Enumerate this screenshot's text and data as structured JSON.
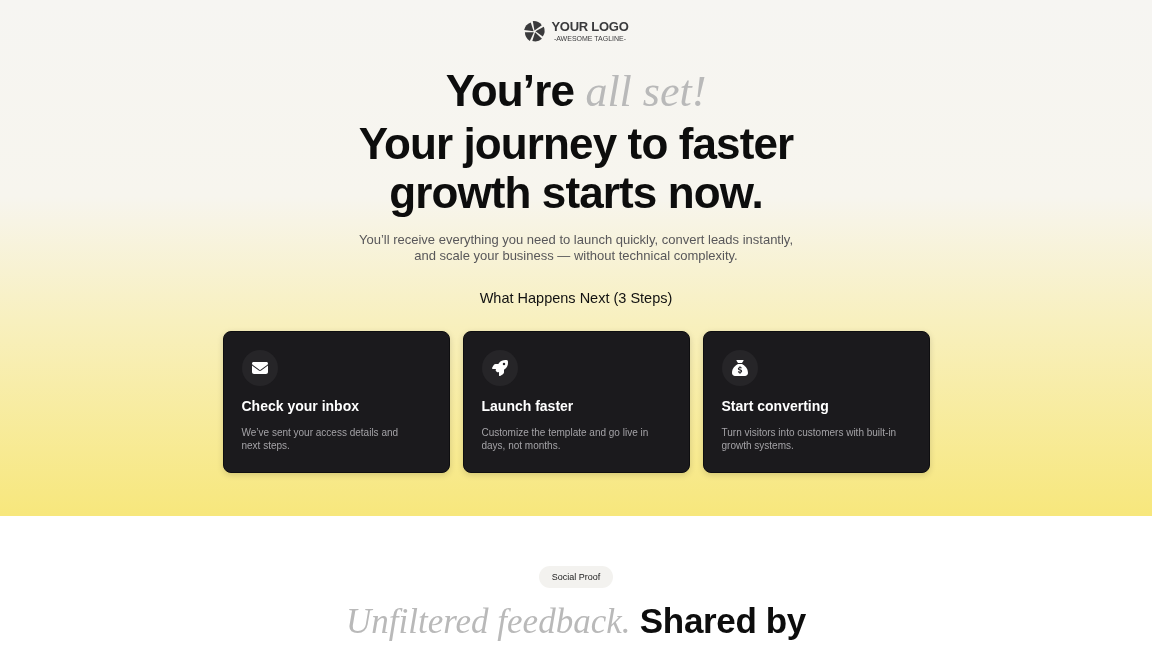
{
  "logo": {
    "name": "YOUR LOGO",
    "tagline": "-AWESOME TAGLINE-"
  },
  "hero": {
    "title_line_1": "You’re *all set!*",
    "title_line_2": "Your journey to faster growth starts now.",
    "subtitle": "You’ll receive everything you need to launch quickly, convert leads instantly, and scale your business — without technical complexity.",
    "steps_heading": "What Happens Next (3 Steps)",
    "steps": [
      {
        "title": "Check your inbox",
        "description": "We’ve sent your access details and next steps."
      },
      {
        "title": "Launch faster",
        "description": "Customize the template and go live in days, not months."
      },
      {
        "title": "Start converting",
        "description": "Turn visitors into customers with built-in growth systems."
      }
    ]
  },
  "social_proof": {
    "label": "Social Proof",
    "heading": "*Unfiltered feedback.* Shared by"
  }
}
